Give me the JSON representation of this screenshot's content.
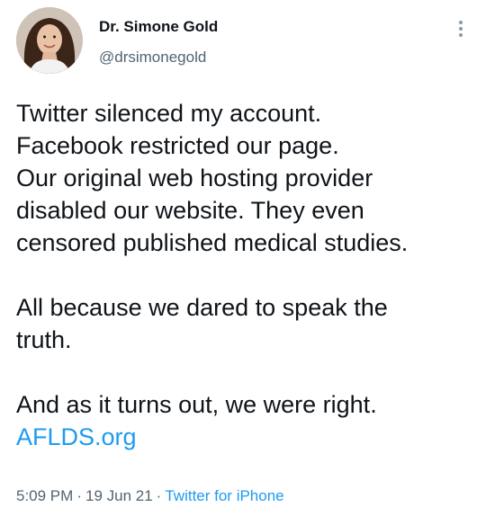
{
  "author": {
    "display_name": "Dr. Simone Gold",
    "handle": "@drsimonegold",
    "avatar_icon": "profile-photo"
  },
  "more_icon": "vertical-ellipsis-icon",
  "tweet": {
    "paragraph1": [
      "Twitter silenced my account.",
      "Facebook restricted our page.",
      "Our original web hosting provider",
      "disabled our website. They even",
      "censored published medical studies."
    ],
    "paragraph2": [
      "All because we dared to speak the",
      "truth."
    ],
    "paragraph3": [
      "And as it turns out, we were right."
    ],
    "link_text": "AFLDS.org"
  },
  "meta": {
    "time": "5:09 PM",
    "separator": "·",
    "date": "19 Jun 21",
    "source": "Twitter for iPhone"
  },
  "colors": {
    "text": "#0f1419",
    "secondary": "#536471",
    "link": "#1d9bf0"
  }
}
